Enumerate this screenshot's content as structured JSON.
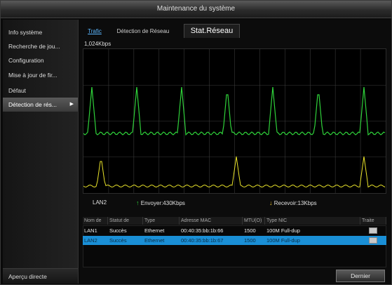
{
  "window": {
    "title": "Maintenance du système"
  },
  "sidebar": {
    "items": [
      {
        "label": "Info système"
      },
      {
        "label": "Recherche de jou..."
      },
      {
        "label": "Configuration"
      },
      {
        "label": "Mise à jour de fir..."
      },
      {
        "label": "Défaut"
      },
      {
        "label": "Détection de rés..."
      }
    ],
    "active_index": 5,
    "bottom_label": "Aperçu directe"
  },
  "tabs": [
    {
      "label": "Trafic"
    },
    {
      "label": "Détection de Réseau"
    },
    {
      "label": "Stat.Réseau"
    }
  ],
  "traffic": {
    "scale_label": "1,024Kbps",
    "interface_label": "LAN2",
    "send_label": "Envoyer:430Kbps",
    "receive_label": "Recevoir:13Kbps",
    "colors": {
      "send": "#2fd23a",
      "receive": "#e8e22a",
      "grid": "#3a3a3a"
    }
  },
  "table": {
    "headers": [
      "Nom de",
      "Statut de",
      "Type",
      "Adresse MAC",
      "MTU(O)",
      "Type NIC",
      "Traite"
    ],
    "rows": [
      {
        "name": "LAN1",
        "status": "Succès",
        "type": "Ethernet",
        "mac": "00:40:35:bb:1b:66",
        "mtu": "1500",
        "nic": "100M Full-dup"
      },
      {
        "name": "LAN2",
        "status": "Succès",
        "type": "Ethernet",
        "mac": "00:40:35:bb:1b:67",
        "mtu": "1500",
        "nic": "100M Full-dup"
      }
    ],
    "selected_index": 1
  },
  "footer": {
    "back_label": "Dernier"
  }
}
